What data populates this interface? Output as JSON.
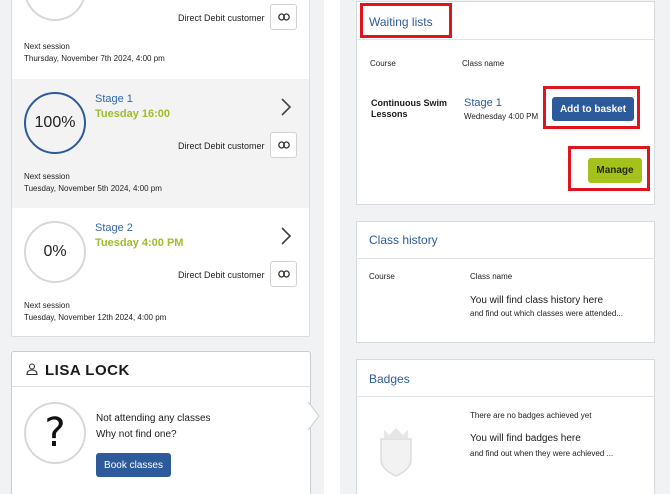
{
  "classes": [
    {
      "percent": "",
      "stage": "",
      "time": "",
      "payment": "Direct Debit customer",
      "next_label": "Next session",
      "next_value": "Thursday, November 7th 2024, 4:00 pm"
    },
    {
      "percent": "100%",
      "stage": "Stage 1",
      "time": "Tuesday 16:00",
      "payment": "Direct Debit customer",
      "next_label": "Next session",
      "next_value": "Tuesday, November 5th 2024, 4:00 pm"
    },
    {
      "percent": "0%",
      "stage": "Stage 2",
      "time": "Tuesday 4:00 PM",
      "payment": "Direct Debit customer",
      "next_label": "Next session",
      "next_value": "Tuesday, November 12th 2024, 4:00 pm"
    }
  ],
  "member": {
    "name": "LISA LOCK",
    "line1": "Not attending any classes",
    "line2": "Why not find one?",
    "book_label": "Book classes",
    "placeholder_icon": "question-mark"
  },
  "waiting_lists": {
    "title": "Waiting lists",
    "col_course": "Course",
    "col_class": "Class name",
    "course": "Continuous Swim Lessons",
    "class_name": "Stage 1",
    "class_time": "Wednesday 4:00 PM",
    "add_label": "Add to basket",
    "manage_label": "Manage"
  },
  "class_history": {
    "title": "Class history",
    "col_course": "Course",
    "col_class": "Class name",
    "empty_title": "You will find class history here",
    "empty_sub": "and find out which classes were attended..."
  },
  "badges": {
    "title": "Badges",
    "none_text": "There are no badges achieved yet",
    "empty_title": "You will find badges here",
    "empty_sub": "and find out when they were achieved ..."
  },
  "colors": {
    "accent_blue": "#2d5a9b",
    "accent_green": "#a4c21b",
    "highlight_red": "#e0141e"
  }
}
